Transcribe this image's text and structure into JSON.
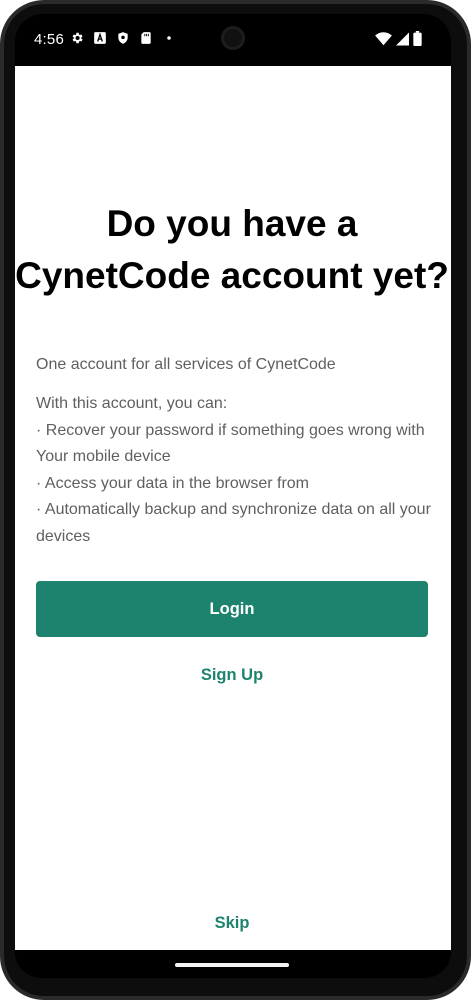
{
  "status_bar": {
    "time": "4:56",
    "left_icons": [
      "settings-gear-icon",
      "font-a-icon",
      "shield-icon",
      "sd-card-icon",
      "dot-icon"
    ],
    "right_icons": [
      "wifi-icon",
      "cellular-signal-icon",
      "battery-icon"
    ]
  },
  "onboarding": {
    "title": "Do you have a CynetCode account yet?",
    "subtitle": "One account for all services of CynetCode",
    "features_intro": "With this account, you can:",
    "features": [
      "· Recover your password if something goes wrong with",
      "Your mobile device",
      "· Access your data in the browser from",
      "· Automatically backup and synchronize data on all your",
      "devices"
    ],
    "login_label": "Login",
    "signup_label": "Sign Up",
    "skip_label": "Skip"
  },
  "colors": {
    "accent": "#1e836e",
    "title": "#000000",
    "body_text": "#5f5f5f",
    "background": "#ffffff"
  }
}
